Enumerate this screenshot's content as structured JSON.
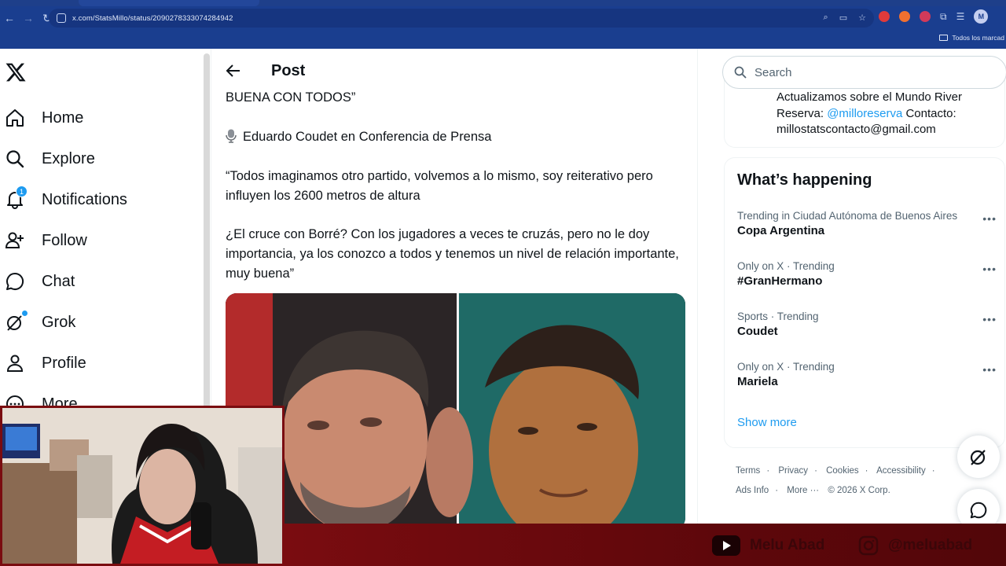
{
  "browser": {
    "url": "x.com/StatsMillo/status/2090278333074284942",
    "bookmarks_label": "Todos los marcad",
    "profile_initial": "M"
  },
  "nav": {
    "items": [
      {
        "label": "Home",
        "icon": "home-icon"
      },
      {
        "label": "Explore",
        "icon": "search-icon"
      },
      {
        "label": "Notifications",
        "icon": "bell-icon",
        "badge": "1"
      },
      {
        "label": "Follow",
        "icon": "follow-icon"
      },
      {
        "label": "Chat",
        "icon": "chat-icon"
      },
      {
        "label": "Grok",
        "icon": "grok-icon"
      },
      {
        "label": "Profile",
        "icon": "profile-icon"
      },
      {
        "label": "More",
        "icon": "more-icon"
      }
    ]
  },
  "post": {
    "header_title": "Post",
    "quote_end": "BUENA CON TODOS”",
    "source_line": "Eduardo Coudet en Conferencia de Prensa",
    "paragraph1": "“Todos imaginamos otro partido, volvemos a lo mismo, soy reiterativo pero influyen los 2600 metros de altura",
    "paragraph2": "¿El cruce con Borré? Con los jugadores a veces te cruzás, pero no le doy importancia, ya los conozco a todos y tenemos un nivel de relación importante, muy buena”"
  },
  "search": {
    "placeholder": "Search"
  },
  "bio": {
    "line_a": "Actualizamos sobre el Mundo River",
    "line_b_prefix": "Reserva: ",
    "line_b_link": "@milloreserva",
    "line_b_suffix": " Contacto:",
    "line_c": "millostatscontacto@gmail.com"
  },
  "whats_happening": {
    "title": "What’s happening",
    "trends": [
      {
        "context": "Trending in Ciudad Autónoma de Buenos Aires",
        "name": "Copa Argentina"
      },
      {
        "context": "Only on X · Trending",
        "name": "#GranHermano"
      },
      {
        "context": "Sports · Trending",
        "name": "Coudet"
      },
      {
        "context": "Only on X · Trending",
        "name": "Mariela"
      }
    ],
    "show_more": "Show more"
  },
  "footer": {
    "links": [
      "Terms",
      "Privacy",
      "Cookies",
      "Accessibility",
      "Ads Info",
      "More ···"
    ],
    "copyright": "© 2026 X Corp."
  },
  "overlay": {
    "youtube_handle": "Melu Abad",
    "instagram_handle": "@meluabad"
  },
  "colors": {
    "accent": "#1d9bf0",
    "browser_chrome": "#1a3e8f",
    "overlay_red": "#7a0c10"
  }
}
